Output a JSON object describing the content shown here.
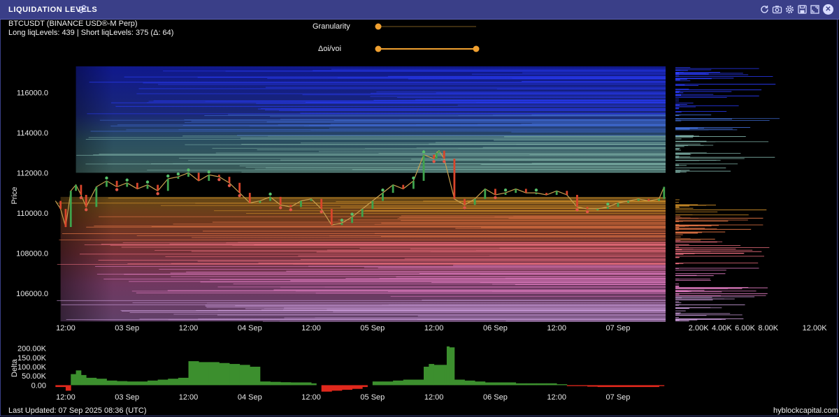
{
  "window": {
    "title": "LIQUIDATION LEVELS",
    "icons": [
      "sliders-icon",
      "refresh-icon",
      "camera-icon",
      "gear-icon",
      "save-icon",
      "expand-icon",
      "close-icon"
    ]
  },
  "header": {
    "symbol": "BTCUSDT (BINANCE USD®-M Perp)",
    "levels_summary": "Long liqLevels: 439 | Short liqLevels: 375 (Δ: 64)"
  },
  "controls": {
    "granularity_label": "Granularity",
    "granularity_value": 0.0,
    "doivoi_label": "Δoi/voi",
    "doivoi_range": [
      0.0,
      1.0
    ]
  },
  "footer": {
    "last_updated": "Last Updated: 07 Sep 2025 08:36 (UTC)",
    "brand": "hyblockcapital.com"
  },
  "colors": {
    "up_candle": "#3fa34d",
    "down_candle": "#d9452b",
    "delta_positive": "#3c8f2e",
    "delta_negative": "#e0281c",
    "slider_accent": "#f0a030",
    "titlebar": "#3a3f88"
  },
  "chart_data": [
    {
      "type": "line",
      "name": "price",
      "ylabel": "Price",
      "y_ticks": [
        "106000.0",
        "108000.0",
        "110000.0",
        "112000.0",
        "114000.0",
        "116000.0"
      ],
      "y_tick_values": [
        106000,
        108000,
        110000,
        112000,
        114000,
        116000
      ],
      "ylim": [
        104500,
        117300
      ],
      "x_ticks": [
        "12:00",
        "03 Sep",
        "12:00",
        "04 Sep",
        "12:00",
        "05 Sep",
        "12:00",
        "06 Sep",
        "12:00",
        "07 Sep"
      ],
      "x_tick_hours": [
        12,
        24,
        36,
        48,
        60,
        72,
        84,
        96,
        108,
        120
      ],
      "xlim_hours": [
        9,
        129.3
      ],
      "x_hours": [
        10,
        11,
        12,
        13,
        14,
        15,
        16,
        18,
        20,
        22,
        24,
        26,
        28,
        30,
        32,
        34,
        36,
        38,
        40,
        42,
        44,
        46,
        48,
        50,
        52,
        54,
        56,
        58,
        60,
        62,
        64,
        66,
        68,
        70,
        72,
        74,
        76,
        78,
        80,
        82,
        84,
        84.5,
        85,
        86,
        88,
        90,
        92,
        94,
        96,
        98,
        100,
        102,
        104,
        106,
        108,
        110,
        112,
        114,
        116,
        118,
        120,
        122,
        124,
        126,
        128,
        129
      ],
      "values": [
        110600,
        110200,
        109300,
        111100,
        111400,
        110900,
        110300,
        111300,
        111600,
        111300,
        111500,
        111200,
        111400,
        111100,
        111700,
        111800,
        112000,
        111600,
        111900,
        111800,
        111500,
        111000,
        110500,
        110600,
        110800,
        110400,
        110300,
        110600,
        110700,
        110200,
        109400,
        109500,
        109800,
        110200,
        110600,
        111000,
        111400,
        111200,
        111600,
        112900,
        112700,
        113000,
        113100,
        112700,
        110700,
        110400,
        110700,
        111200,
        110900,
        111000,
        111200,
        111000,
        111000,
        110900,
        111100,
        110900,
        110300,
        110200,
        110200,
        110300,
        110500,
        110600,
        110700,
        110600,
        110700,
        111300
      ],
      "bands": [
        {
          "name": "short liquidation levels",
          "range": [
            112000,
            117300
          ]
        },
        {
          "name": "long liquidation levels",
          "range": [
            104600,
            110800
          ]
        }
      ]
    },
    {
      "type": "bar",
      "name": "liquidation level volume profile",
      "x_ticks": [
        "2.00K",
        "4.00K",
        "6.00K",
        "8.00K",
        "12.00K"
      ],
      "x_tick_values": [
        2000,
        4000,
        6000,
        8000,
        12000
      ],
      "xlim": [
        0,
        13500
      ]
    },
    {
      "type": "area",
      "name": "delta",
      "ylabel": "Delta",
      "y_ticks": [
        "0.00",
        "50.00K",
        "100.00K",
        "150.00K",
        "200.00K"
      ],
      "y_tick_values": [
        0,
        50000,
        100000,
        150000,
        200000
      ],
      "ylim": [
        -40000,
        225000
      ],
      "x_ticks": [
        "12:00",
        "03 Sep",
        "12:00",
        "04 Sep",
        "12:00",
        "05 Sep",
        "12:00",
        "06 Sep",
        "12:00",
        "07 Sep"
      ],
      "x_hours": [
        10,
        12,
        13,
        14,
        15,
        16,
        18,
        20,
        22,
        24,
        26,
        28,
        30,
        32,
        34,
        36,
        38,
        40,
        42,
        44,
        46,
        48,
        50,
        52,
        54,
        56,
        58,
        60,
        61,
        62,
        64,
        66,
        68,
        70,
        71,
        72,
        74,
        76,
        78,
        80,
        82,
        83,
        84,
        86,
        86.5,
        87,
        88,
        90,
        92,
        94,
        96,
        98,
        100,
        102,
        104,
        106,
        108,
        110,
        112,
        114,
        116,
        118,
        120,
        122,
        124,
        126,
        128,
        129
      ],
      "values": [
        -10000,
        -30000,
        60000,
        80000,
        55000,
        40000,
        35000,
        25000,
        22000,
        20000,
        20000,
        25000,
        30000,
        35000,
        40000,
        130000,
        125000,
        125000,
        120000,
        115000,
        110000,
        100000,
        20000,
        18000,
        16000,
        15000,
        15000,
        10000,
        0,
        -35000,
        -30000,
        -25000,
        -20000,
        -10000,
        0,
        20000,
        20000,
        25000,
        30000,
        30000,
        100000,
        115000,
        110000,
        110000,
        210000,
        205000,
        30000,
        25000,
        20000,
        15000,
        15000,
        15000,
        10000,
        10000,
        10000,
        10000,
        5000,
        -5000,
        -5000,
        -8000,
        -10000,
        -10000,
        -10000,
        -10000,
        -10000,
        -10000,
        -5000,
        40000
      ]
    }
  ]
}
